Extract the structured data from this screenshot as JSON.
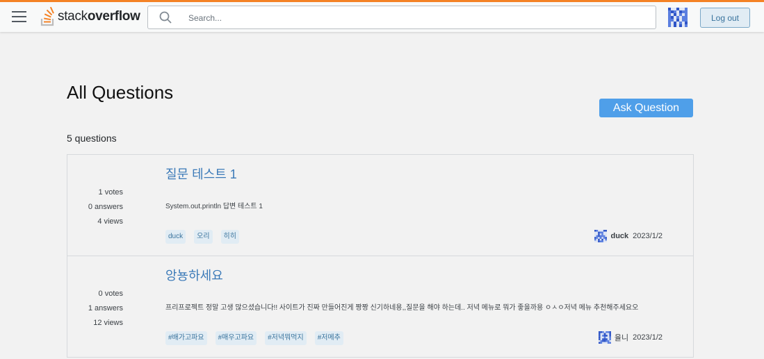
{
  "header": {
    "logo_regular": "stack",
    "logo_bold": "overflow",
    "search_placeholder": "Search...",
    "logout_label": "Log out",
    "accent": "#f48225"
  },
  "main": {
    "title": "All Questions",
    "ask_label": "Ask Question",
    "count_text": "5 questions"
  },
  "questions": [
    {
      "title": "질문 테스트 1",
      "votes": "1 votes",
      "answers": "0 answers",
      "views": "4 views",
      "excerpt": "System.out.println 답변 테스트 1",
      "tags": [
        "duck",
        "오리",
        "히히"
      ],
      "user": "duck",
      "date": "2023/1/2"
    },
    {
      "title": "앙뇽하세요",
      "votes": "0 votes",
      "answers": "1 answers",
      "views": "12 views",
      "excerpt": "프리프로젝트 정말 고생 많으셨습니다!! 사이트가 진짜 만들어진게 짱짱 신기하네용,,질문을 해야 하는데.. 저녁 메뉴로 뭐가 좋을까용 ㅇㅅㅇ저녁 메뉴 추천해주세요오",
      "tags": [
        "#배가고파요",
        "#매우고파요",
        "#저녁뭐먹지",
        "#저메추"
      ],
      "user": "율니",
      "date": "2023/1/2"
    }
  ]
}
